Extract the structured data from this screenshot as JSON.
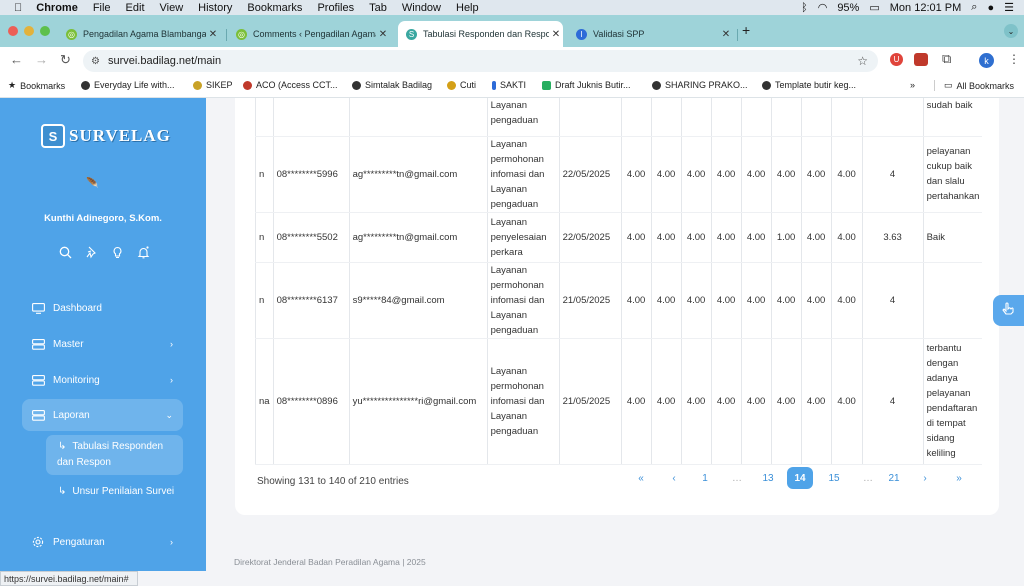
{
  "menubar": {
    "app": "Chrome",
    "items": [
      "File",
      "Edit",
      "View",
      "History",
      "Bookmarks",
      "Profiles",
      "Tab",
      "Window",
      "Help"
    ],
    "battery": "95%",
    "clock": "Mon 12:01 PM"
  },
  "tabs": [
    {
      "title": "Pengadilan Agama Blambangan",
      "color": "#7bbf3a",
      "active": false
    },
    {
      "title": "Comments ‹ Pengadilan Agama",
      "color": "#7bbf3a",
      "active": false
    },
    {
      "title": "Tabulasi Responden dan Respon",
      "color": "#3aa7a0",
      "active": true
    },
    {
      "title": "Validasi SPP",
      "color": "#2d6bd8",
      "active": false
    }
  ],
  "address": {
    "url": "survei.badilag.net/main",
    "profile": "k"
  },
  "bookmarks": [
    {
      "label": "Bookmarks",
      "color": "#222"
    },
    {
      "label": "Everyday Life with...",
      "color": "#333"
    },
    {
      "label": "SIKEP",
      "color": "#c9a227"
    },
    {
      "label": "ACO (Access CCT...",
      "color": "#c0392b"
    },
    {
      "label": "Simtalak Badilag",
      "color": "#333"
    },
    {
      "label": "Cuti",
      "color": "#d4a017"
    },
    {
      "label": "SAKTI",
      "color": "#2d6bd8"
    },
    {
      "label": "Draft Juknis Butir...",
      "color": "#27ae60"
    },
    {
      "label": "SHARING PRAKO...",
      "color": "#333"
    },
    {
      "label": "Template butir keg...",
      "color": "#333"
    }
  ],
  "all_bookmarks": "All Bookmarks",
  "sidebar": {
    "brand": "SURVELAG",
    "user": "Kunthi Adinegoro, S.Kom.",
    "menu": [
      {
        "label": "Dashboard",
        "icon": "monitor-icon",
        "chev": ""
      },
      {
        "label": "Master",
        "icon": "database-icon",
        "chev": "›"
      },
      {
        "label": "Monitoring",
        "icon": "database-icon",
        "chev": "›"
      },
      {
        "label": "Laporan",
        "icon": "database-icon",
        "chev": "⌄"
      },
      {
        "label": "Pengaturan",
        "icon": "gear-icon",
        "chev": "›"
      }
    ],
    "submenu": [
      {
        "label": "Tabulasi Responden dan Respon",
        "active": true
      },
      {
        "label": "Unsur Penilaian Survei",
        "active": false
      }
    ]
  },
  "table": {
    "rows": [
      {
        "lead": "",
        "phone": "",
        "email": "",
        "layanan": "Layanan pengaduan",
        "date": "",
        "scores": [
          "",
          "",
          "",
          "",
          "",
          "",
          "",
          ""
        ],
        "avg": "",
        "comment": "sudah baik"
      },
      {
        "lead": "n",
        "phone": "08********5996",
        "email": "ag*********tn@gmail.com",
        "layanan": "Layanan permohonan infomasi dan Layanan pengaduan",
        "date": "22/05/2025",
        "scores": [
          "4.00",
          "4.00",
          "4.00",
          "4.00",
          "4.00",
          "4.00",
          "4.00",
          "4.00"
        ],
        "avg": "4",
        "comment": "pelayanan cukup baik dan slalu pertahankan"
      },
      {
        "lead": "n",
        "phone": "08********5502",
        "email": "ag*********tn@gmail.com",
        "layanan": "Layanan penyelesaian perkara",
        "date": "22/05/2025",
        "scores": [
          "4.00",
          "4.00",
          "4.00",
          "4.00",
          "4.00",
          "1.00",
          "4.00",
          "4.00"
        ],
        "avg": "3.63",
        "comment": "Baik"
      },
      {
        "lead": "n",
        "phone": "08********6137",
        "email": "s9*****84@gmail.com",
        "layanan": "Layanan permohonan infomasi dan Layanan pengaduan",
        "date": "21/05/2025",
        "scores": [
          "4.00",
          "4.00",
          "4.00",
          "4.00",
          "4.00",
          "4.00",
          "4.00",
          "4.00"
        ],
        "avg": "4",
        "comment": ""
      },
      {
        "lead": "na",
        "phone": "08********0896",
        "email": "yu***************ri@gmail.com",
        "layanan": "Layanan permohonan infomasi dan Layanan pengaduan",
        "date": "21/05/2025",
        "scores": [
          "4.00",
          "4.00",
          "4.00",
          "4.00",
          "4.00",
          "4.00",
          "4.00",
          "4.00"
        ],
        "avg": "4",
        "comment": "terbantu dengan adanya pelayanan pendaftaran di tempat sidang keliling"
      }
    ],
    "info": "Showing 131 to 140 of 210 entries",
    "pagination": [
      "«",
      "‹",
      "1",
      "…",
      "13",
      "14",
      "15",
      "…",
      "21",
      "›",
      "»"
    ],
    "current_page": "14"
  },
  "footer": "Direktorat Jenderal Badan Peradilan Agama | 2025",
  "status_url": "https://survei.badilag.net/main#"
}
